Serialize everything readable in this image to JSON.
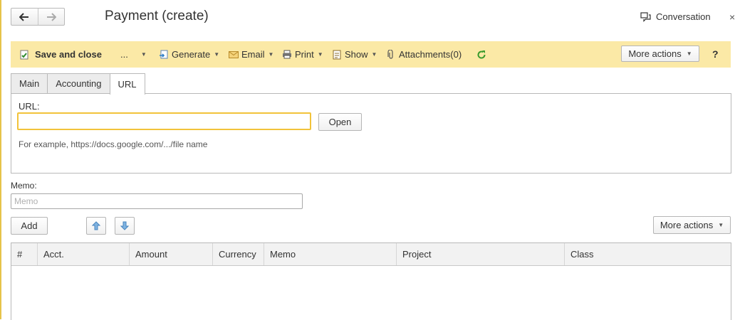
{
  "header": {
    "title": "Payment (create)",
    "conversation_label": "Conversation",
    "close_glyph": "×"
  },
  "toolbar": {
    "save_close": "Save and close",
    "more_dots": "...",
    "generate": "Generate",
    "email": "Email",
    "print": "Print",
    "show": "Show",
    "attachments": "Attachments(0)",
    "more_actions": "More actions",
    "help": "?"
  },
  "tabs": [
    {
      "label": "Main"
    },
    {
      "label": "Accounting"
    },
    {
      "label": "URL",
      "active": true
    }
  ],
  "url_tab": {
    "label": "URL:",
    "value": "",
    "open_button": "Open",
    "hint": "For example, https://docs.google.com/.../file  name"
  },
  "memo": {
    "label": "Memo:",
    "placeholder": "Memo",
    "value": ""
  },
  "table_toolbar": {
    "add": "Add",
    "more_actions": "More actions"
  },
  "table": {
    "columns": [
      "#",
      "Acct.",
      "Amount",
      "Currency",
      "Memo",
      "Project",
      "Class"
    ],
    "rows": []
  },
  "colors": {
    "toolbar_bg": "#fbe9a6",
    "input_focus": "#f2c33a",
    "refresh_green": "#3a9a2c"
  }
}
